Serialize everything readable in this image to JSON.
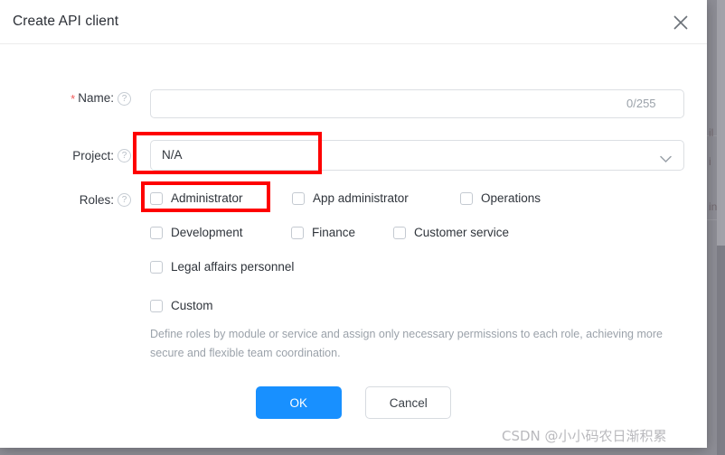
{
  "dialog": {
    "title": "Create API client",
    "close_icon": "close-icon"
  },
  "fields": {
    "name": {
      "label": "Name:",
      "required_marker": "*",
      "help_icon": "help-circle-icon",
      "value": "",
      "placeholder": "",
      "counter": "0/255"
    },
    "project": {
      "label": "Project:",
      "help_icon": "help-circle-icon",
      "value": "N/A",
      "chevron_icon": "chevron-down-icon"
    },
    "roles": {
      "label": "Roles:",
      "help_icon": "help-circle-icon",
      "options": [
        {
          "label": "Administrator",
          "checked": false
        },
        {
          "label": "App administrator",
          "checked": false
        },
        {
          "label": "Operations",
          "checked": false
        },
        {
          "label": "Development",
          "checked": false
        },
        {
          "label": "Finance",
          "checked": false
        },
        {
          "label": "Customer service",
          "checked": false
        },
        {
          "label": "Legal affairs personnel",
          "checked": false
        },
        {
          "label": "Custom",
          "checked": false
        }
      ],
      "hint": "Define roles by module or service and assign only necessary permissions to each role, achieving more secure and flexible team coordination."
    }
  },
  "footer": {
    "ok_label": "OK",
    "cancel_label": "Cancel"
  },
  "annotations": {
    "color": "#fe0000",
    "project_box": "highlight-project-field",
    "administrator_box": "highlight-administrator-checkbox"
  },
  "background": {
    "fragment_1": "il",
    "fragment_2": "in",
    "fragment_3": "i"
  },
  "watermark": {
    "text": "CSDN @小小码农日渐积累"
  }
}
